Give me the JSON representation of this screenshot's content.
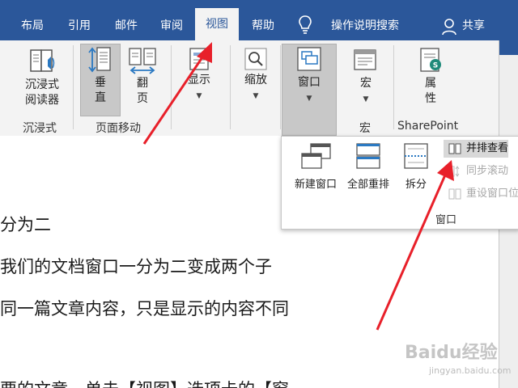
{
  "tabs": [
    {
      "label": "布局"
    },
    {
      "label": "引用"
    },
    {
      "label": "邮件"
    },
    {
      "label": "审阅"
    },
    {
      "label": "视图"
    },
    {
      "label": "帮助"
    }
  ],
  "search_label": "操作说明搜索",
  "share_label": "共享",
  "ribbon": {
    "immersive": {
      "btn1": "沉浸式",
      "btn2": "阅读器",
      "group": "沉浸式"
    },
    "pagemove": {
      "vertical1": "垂",
      "vertical2": "直",
      "flip1": "翻",
      "flip2": "页",
      "group": "页面移动"
    },
    "show": {
      "label": "显示"
    },
    "zoom": {
      "label": "缩放"
    },
    "window": {
      "label": "窗口"
    },
    "macro": {
      "label": "宏",
      "group": "宏"
    },
    "props": {
      "label1": "属",
      "label2": "性",
      "group": "SharePoint"
    }
  },
  "popup": {
    "new_window": "新建窗口",
    "arrange_all": "全部重排",
    "split": "拆分",
    "side_by_side": "并排查看",
    "sync_scroll": "同步滚动",
    "reset_position": "重设窗口位",
    "group_label": "窗口"
  },
  "document": {
    "lines": [
      "分为二",
      "我们的文档窗口一分为二变成两个子",
      "同一篇文章内容，只是显示的内容不同",
      "",
      "要的文章，单击【视图】选项卡的【窗"
    ]
  },
  "watermark": {
    "brand": "Baidu经验",
    "url": "jingyan.baidu.com"
  },
  "colors": {
    "accent": "#2b579a",
    "arrow": "#e8202a"
  }
}
